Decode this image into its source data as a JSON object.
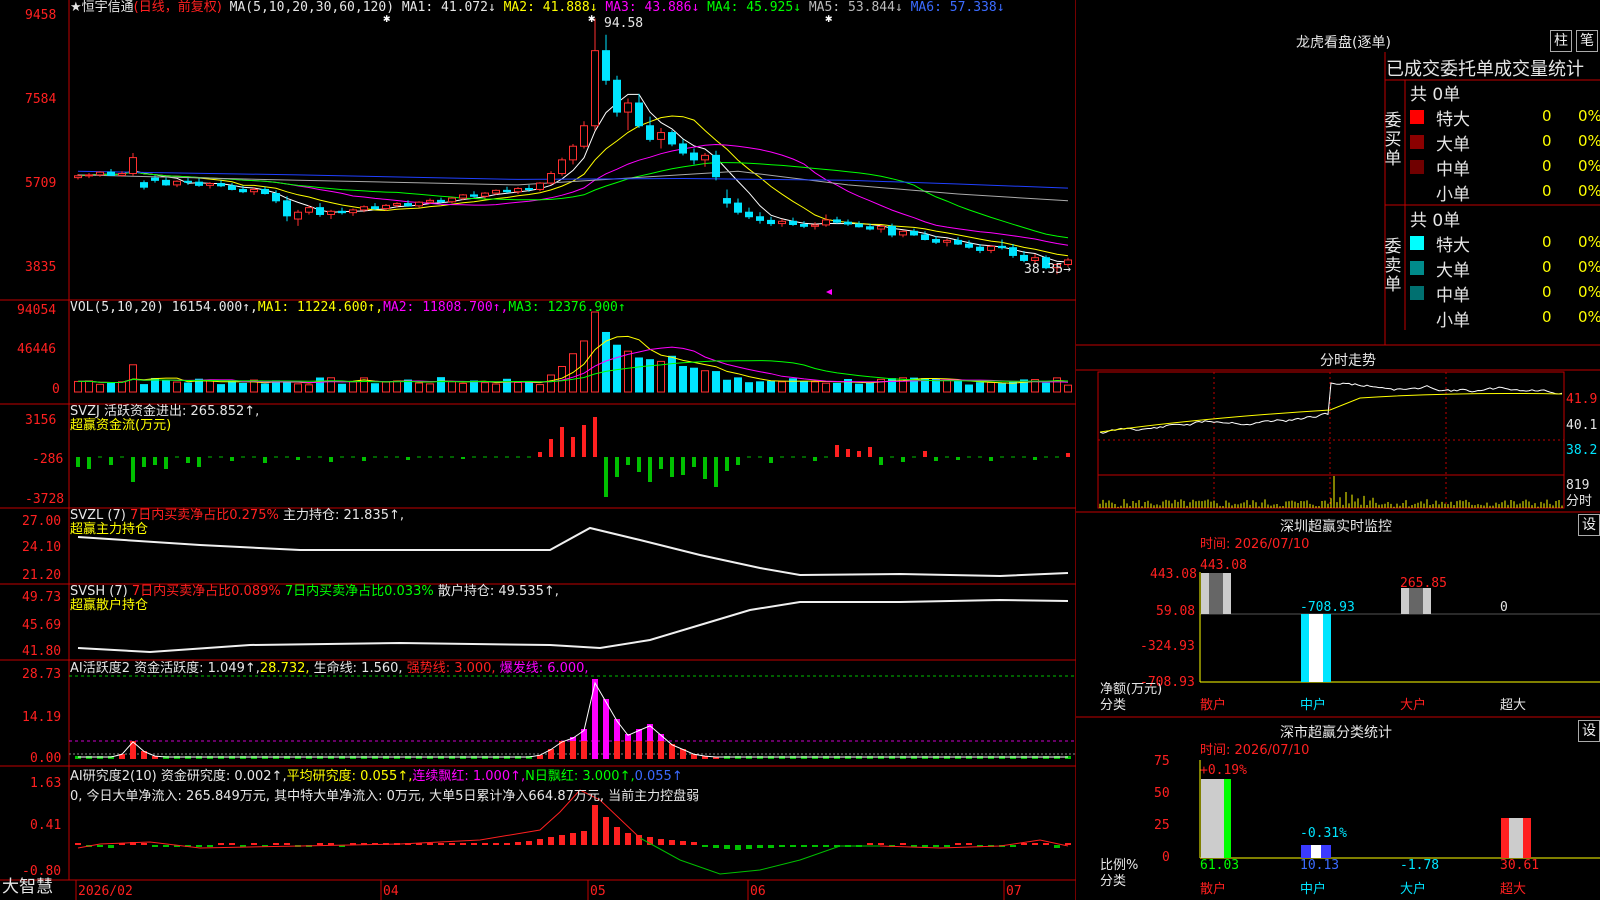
{
  "stock": {
    "star": "★",
    "name": "恒宇信通",
    "period": "(日线，前复权)",
    "brand": "大智慧"
  },
  "main_header": {
    "ma_params": "MA(5,10,20,30,60,120)",
    "ma1": "MA1: 41.072↓",
    "ma2": "MA2: 41.888↓",
    "ma3": "MA3: 43.886↓",
    "ma4": "MA4: 45.925↓",
    "ma5": "MA5: 53.844↓",
    "ma6": "MA6: 57.338↓"
  },
  "main_yticks": [
    "9458",
    "7584",
    "5709",
    "3835"
  ],
  "annotations": {
    "high": "94.58",
    "low": "38.35→"
  },
  "vol_header": {
    "p": "VOL(5,10,20)",
    "v": "16154.000↑,",
    "m1": "MA1: 11224.600↑,",
    "m2": "MA2: 11808.700↑,",
    "m3": "MA3: 12376.900↑"
  },
  "vol_yticks": [
    "94054",
    "46446",
    "0"
  ],
  "svzj_header": {
    "a": "SVZJ  活跃资金进出: 265.852↑,",
    "b": "超赢资金流(万元)"
  },
  "svzj_yticks": [
    "3156",
    "-286",
    "-3728"
  ],
  "svzl_header": {
    "p": "SVZL (7)",
    "a": "7日内买卖净占比0.275%",
    "b": "主力持仓: 21.835↑,",
    "c": "超赢主力持仓"
  },
  "svzl_yticks": [
    "27.00",
    "24.10",
    "21.20"
  ],
  "svsh_header": {
    "p": "SVSH (7)",
    "a": "7日内买卖净占比0.089%",
    "b": "7日内买卖净占比0.033%",
    "c": "散户持仓: 49.535↑,",
    "d": "超赢散户持仓"
  },
  "svsh_yticks": [
    "49.73",
    "45.69",
    "41.80"
  ],
  "ai1_header": {
    "a": "AI活跃度2",
    "b": "资金活跃度: 1.049↑,",
    "c": "28.732,",
    "d": "生命线: 1.560,",
    "e": "强势线: 3.000,",
    "f": "爆发线: 6.000,"
  },
  "ai1_yticks": [
    "28.73",
    "14.19",
    "0.00"
  ],
  "ai2_header": {
    "a": "AI研究度2(10)",
    "b": "资金研究度: 0.002↑,",
    "c": "平均研究度: 0.055↑,",
    "d": "连续飘红: 1.000↑,",
    "e": "N日飘红: 3.000↑,",
    "f": "0.055↑",
    "g": "0, 今日大单净流入: 265.849万元, 其中特大单净流入: 0万元, 大单5日累计净入664.87万元, 当前主力控盘弱"
  },
  "ai2_yticks": [
    "1.63",
    "0.41",
    "-0.80"
  ],
  "x_axis": [
    "2026/02",
    "04",
    "05",
    "06",
    "07"
  ],
  "side": {
    "lhb_title": "龙虎看盘(逐单)",
    "btn_bar": "柱",
    "btn_pen": "笔",
    "stats_title": "已成交委托单成交量统计",
    "buy_label": "委买单",
    "sell_label": "委卖单",
    "buy_total": "共 0单",
    "sell_total": "共 0单",
    "rows": [
      {
        "label": "特大",
        "num": "0",
        "pct": "0%"
      },
      {
        "label": "大单",
        "num": "0",
        "pct": "0%"
      },
      {
        "label": "中单",
        "num": "0",
        "pct": "0%"
      },
      {
        "label": "小单",
        "num": "0",
        "pct": "0%"
      }
    ],
    "buy_colors": [
      "#ff0000",
      "#8b0000",
      "#700000",
      "#000000"
    ],
    "sell_colors": [
      "#00ffff",
      "#008b8b",
      "#007070",
      "#000000"
    ],
    "ts_title": "分时走势",
    "ts_prices": [
      "41.9",
      "40.1",
      "38.2"
    ],
    "ts_vol": "819",
    "ts_vol_unit": "分时",
    "monitor_title": "深圳超赢实时监控",
    "btn_set": "设",
    "monitor_time": "时间: 2026/07/10",
    "monitor_yticks": [
      "443.08",
      "59.08",
      "-324.93",
      "-708.93"
    ],
    "monitor_vals": [
      "443.08",
      "-708.93",
      "265.85",
      "0"
    ],
    "monitor_ylabel": "净额(万元)",
    "monitor_xlabel": "分类",
    "cats": [
      "散户",
      "中户",
      "大户",
      "超大"
    ],
    "class_title": "深市超赢分类统计",
    "class_time": "时间: 2026/07/10",
    "class_yticks": [
      "75",
      "50",
      "25",
      "0"
    ],
    "class_top": [
      "+0.19%",
      "-0.31%"
    ],
    "class_vals": [
      "61.03",
      "10.13",
      "-1.78",
      "30.61"
    ],
    "class_ylabel": "比例%",
    "class_xlabel": "分类"
  },
  "chart_data": {
    "type": "candlestick",
    "candles_ohlc_approx": [
      [
        59.6,
        60.4,
        59.2,
        60.0
      ],
      [
        60.0,
        60.6,
        59.5,
        60.2
      ],
      [
        60.2,
        61.0,
        59.8,
        60.8
      ],
      [
        60.8,
        61.5,
        60.0,
        60.1
      ],
      [
        60.1,
        61.0,
        59.8,
        60.5
      ],
      [
        60.5,
        65.0,
        60.0,
        64.0
      ],
      [
        58.5,
        59.0,
        57.0,
        57.5
      ],
      [
        59.5,
        60.0,
        58.5,
        59.0
      ],
      [
        59.0,
        59.6,
        57.8,
        58.0
      ],
      [
        58.0,
        59.0,
        57.5,
        58.8
      ],
      [
        58.8,
        59.5,
        58.0,
        58.6
      ],
      [
        58.6,
        59.4,
        57.6,
        57.9
      ],
      [
        57.9,
        58.6,
        57.2,
        58.3
      ],
      [
        58.3,
        59.0,
        57.5,
        57.8
      ],
      [
        57.8,
        58.4,
        56.8,
        57.0
      ],
      [
        57.0,
        57.8,
        56.2,
        56.5
      ],
      [
        56.5,
        57.5,
        55.8,
        57.0
      ],
      [
        57.0,
        57.6,
        55.9,
        56.1
      ],
      [
        56.1,
        56.8,
        54.0,
        54.5
      ],
      [
        54.5,
        55.5,
        50.0,
        51.2
      ],
      [
        50.5,
        52.5,
        49.0,
        52.0
      ],
      [
        52.0,
        53.5,
        51.5,
        53.0
      ],
      [
        53.0,
        54.0,
        51.0,
        51.5
      ],
      [
        51.5,
        52.5,
        50.5,
        52.2
      ],
      [
        52.2,
        53.0,
        51.5,
        51.9
      ],
      [
        51.9,
        52.8,
        51.2,
        52.5
      ],
      [
        52.5,
        53.5,
        52.0,
        53.2
      ],
      [
        53.2,
        54.0,
        52.5,
        52.8
      ],
      [
        52.8,
        53.8,
        52.3,
        53.5
      ],
      [
        53.5,
        54.2,
        53.0,
        53.9
      ],
      [
        53.9,
        54.6,
        53.2,
        53.4
      ],
      [
        53.4,
        54.4,
        53.0,
        54.2
      ],
      [
        54.2,
        55.0,
        53.8,
        54.6
      ],
      [
        54.6,
        55.2,
        54.0,
        54.3
      ],
      [
        54.3,
        55.3,
        54.0,
        55.1
      ],
      [
        55.1,
        56.0,
        54.6,
        55.8
      ],
      [
        55.8,
        56.6,
        55.2,
        55.5
      ],
      [
        55.5,
        56.4,
        55.0,
        56.2
      ],
      [
        56.2,
        57.0,
        55.8,
        56.8
      ],
      [
        56.8,
        57.6,
        56.2,
        56.5
      ],
      [
        56.5,
        57.5,
        56.0,
        57.2
      ],
      [
        57.2,
        58.0,
        56.5,
        57.0
      ],
      [
        57.0,
        58.6,
        56.6,
        58.4
      ],
      [
        58.4,
        61.0,
        58.0,
        60.5
      ],
      [
        60.5,
        64.0,
        60.0,
        63.5
      ],
      [
        63.5,
        67.0,
        62.5,
        66.5
      ],
      [
        66.5,
        72.0,
        66.0,
        71.0
      ],
      [
        71.0,
        94.58,
        70.0,
        87.5
      ],
      [
        87.5,
        91.0,
        80.0,
        81.0
      ],
      [
        81.0,
        82.0,
        73.0,
        74.0
      ],
      [
        74.0,
        77.0,
        70.0,
        76.0
      ],
      [
        76.0,
        78.0,
        70.5,
        71.0
      ],
      [
        71.0,
        73.0,
        67.5,
        68.0
      ],
      [
        68.0,
        70.5,
        66.0,
        69.5
      ],
      [
        69.5,
        70.0,
        66.5,
        67.0
      ],
      [
        67.0,
        68.0,
        64.5,
        65.0
      ],
      [
        65.0,
        66.0,
        62.5,
        63.5
      ],
      [
        63.5,
        65.0,
        62.0,
        64.5
      ],
      [
        64.5,
        65.5,
        59.0,
        59.8
      ],
      [
        55.0,
        57.0,
        53.0,
        54.0
      ],
      [
        54.0,
        55.0,
        51.5,
        52.0
      ],
      [
        52.0,
        53.0,
        50.5,
        51.0
      ],
      [
        51.0,
        52.0,
        49.5,
        50.2
      ],
      [
        50.2,
        51.0,
        49.0,
        49.5
      ],
      [
        49.5,
        50.5,
        48.8,
        50.0
      ],
      [
        50.0,
        50.8,
        49.0,
        49.3
      ],
      [
        49.3,
        50.0,
        48.5,
        48.9
      ],
      [
        48.9,
        49.8,
        48.2,
        49.2
      ],
      [
        49.2,
        51.5,
        48.8,
        50.3
      ],
      [
        50.3,
        51.0,
        49.5,
        49.8
      ],
      [
        49.8,
        50.4,
        49.0,
        49.4
      ],
      [
        49.4,
        50.0,
        48.6,
        48.8
      ],
      [
        48.8,
        49.5,
        48.0,
        48.3
      ],
      [
        48.3,
        49.2,
        47.5,
        48.9
      ],
      [
        48.9,
        49.5,
        46.5,
        47.0
      ],
      [
        47.0,
        48.0,
        46.5,
        47.8
      ],
      [
        47.8,
        48.4,
        46.8,
        47.0
      ],
      [
        47.0,
        47.8,
        45.8,
        46.0
      ],
      [
        46.0,
        46.8,
        45.0,
        45.4
      ],
      [
        45.4,
        46.2,
        44.5,
        45.8
      ],
      [
        45.8,
        46.5,
        44.8,
        45.0
      ],
      [
        45.0,
        45.8,
        44.0,
        44.3
      ],
      [
        44.3,
        45.0,
        43.0,
        43.6
      ],
      [
        43.6,
        44.8,
        43.0,
        44.5
      ],
      [
        44.5,
        46.0,
        43.8,
        44.2
      ],
      [
        44.2,
        45.0,
        42.0,
        42.5
      ],
      [
        42.5,
        43.5,
        41.0,
        41.4
      ],
      [
        41.4,
        42.8,
        40.5,
        42.0
      ],
      [
        42.0,
        42.5,
        39.5,
        39.8
      ],
      [
        39.8,
        40.8,
        38.35,
        40.5
      ],
      [
        40.5,
        42.0,
        40.0,
        41.5
      ]
    ],
    "ma": {
      "MA1": {
        "color": "#ffffff",
        "last": 41.072
      },
      "MA2": {
        "color": "#ffff00",
        "last": 41.888
      },
      "MA3": {
        "color": "#ff00ff",
        "last": 43.886
      },
      "MA4": {
        "color": "#00ff00",
        "last": 45.925
      },
      "MA5": {
        "color": "#aaaaaa",
        "last": 53.844
      },
      "MA6": {
        "color": "#2040ff",
        "last": 57.338
      }
    },
    "ylim": [
      36.0,
      96.0
    ],
    "x_labels": [
      "2026/02",
      "04",
      "05",
      "06",
      "07"
    ]
  }
}
